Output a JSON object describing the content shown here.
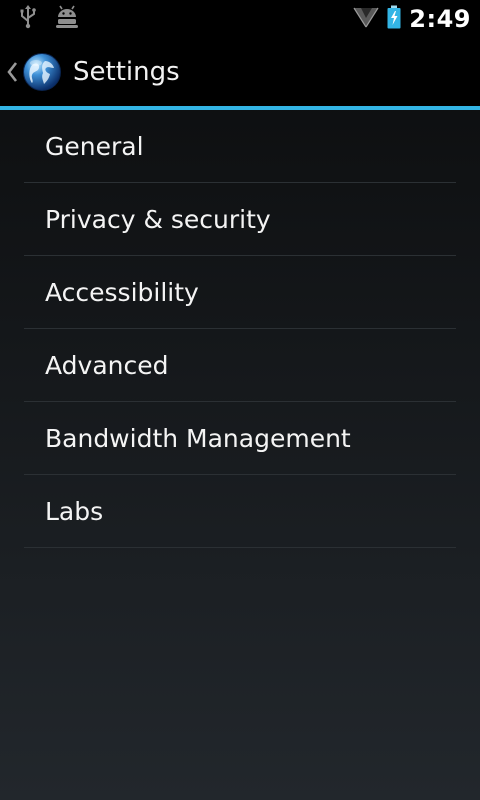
{
  "status_bar": {
    "time": "2:49",
    "icons": [
      "usb-icon",
      "android-debug-icon",
      "signal-icon",
      "battery-charging-icon"
    ]
  },
  "action_bar": {
    "title": "Settings",
    "app_icon": "browser-globe-icon",
    "accent_color": "#33b5e5"
  },
  "settings": {
    "items": [
      {
        "label": "General"
      },
      {
        "label": "Privacy & security"
      },
      {
        "label": "Accessibility"
      },
      {
        "label": "Advanced"
      },
      {
        "label": "Bandwidth Management"
      },
      {
        "label": "Labs"
      }
    ]
  }
}
